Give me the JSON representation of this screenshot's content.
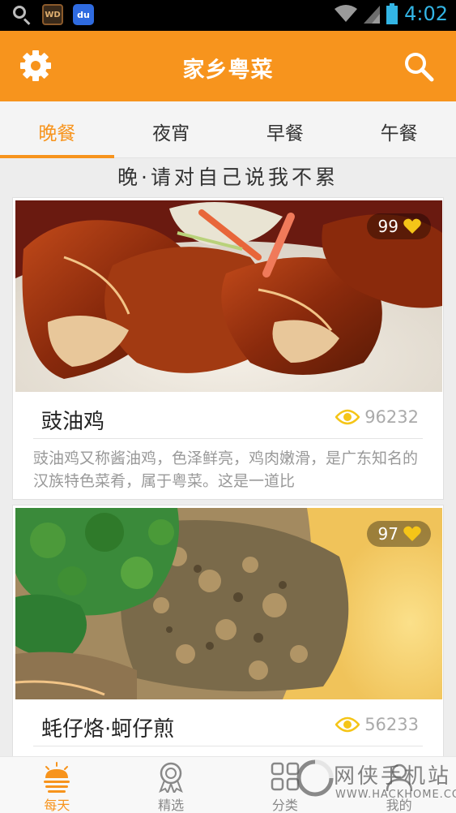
{
  "status_bar": {
    "time": "4:02",
    "app_badge": "WD",
    "baidu_badge": "du"
  },
  "header": {
    "title": "家乡粤菜"
  },
  "tabs": [
    {
      "label": "晚餐",
      "active": true
    },
    {
      "label": "夜宵",
      "active": false
    },
    {
      "label": "早餐",
      "active": false
    },
    {
      "label": "午餐",
      "active": false
    }
  ],
  "subtitle": "晚·请对自己说我不累",
  "cards": [
    {
      "title": "豉油鸡",
      "likes": "99",
      "views": "96232",
      "description": "豉油鸡又称酱油鸡，色泽鲜亮，鸡肉嫩滑，是广东知名的汉族特色菜肴，属于粤菜。这是一道比"
    },
    {
      "title": "蚝仔烙·蚵仔煎",
      "likes": "97",
      "views": "56233",
      "description": ""
    }
  ],
  "bottom_nav": [
    {
      "label": "每天",
      "active": true
    },
    {
      "label": "精选",
      "active": false
    },
    {
      "label": "分类",
      "active": false
    },
    {
      "label": "我的",
      "active": false
    }
  ],
  "watermark": {
    "text": "网侠手机站",
    "url": "WWW.HACKHOME.COM"
  },
  "colors": {
    "accent": "#f7941d",
    "status_bar": "#000000",
    "status_text": "#33b5e5",
    "like_heart": "#f5c518"
  }
}
